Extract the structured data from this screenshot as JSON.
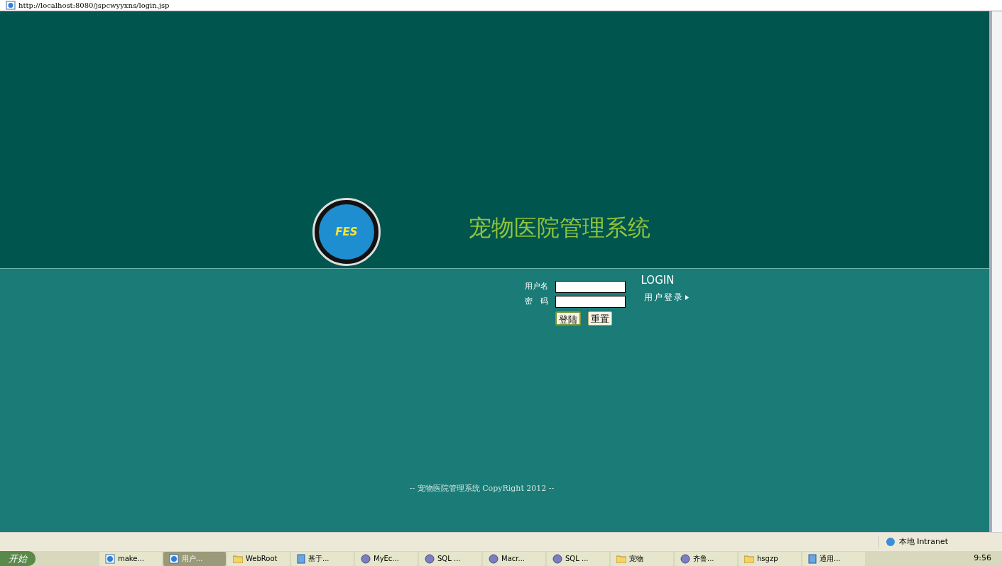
{
  "address_bar": {
    "url": "http://localhost:8080/jspcwyyxns/login.jsp"
  },
  "header": {
    "logo_text": "FES",
    "title": "宠物医院管理系统"
  },
  "login": {
    "heading": "LOGIN",
    "subheading": "用户登录",
    "fields": [
      {
        "label": "用户名"
      },
      {
        "label": "密　码"
      }
    ],
    "buttons": [
      {
        "label": "登陆",
        "focused": true
      },
      {
        "label": "重置",
        "focused": false
      }
    ]
  },
  "footer": "-- 宠物医院管理系统 CopyRight 2012 --",
  "status_bar": {
    "zone": "本地 Intranet"
  },
  "taskbar": {
    "start": "开始",
    "clock": "9:56",
    "tasks": [
      {
        "label": "make...",
        "kind": "browser",
        "selected": false
      },
      {
        "label": "用户...",
        "kind": "browser",
        "selected": true
      },
      {
        "label": "WebRoot",
        "kind": "folder",
        "selected": false
      },
      {
        "label": "基于...",
        "kind": "document",
        "selected": false
      },
      {
        "label": "MyEc...",
        "kind": "app",
        "selected": false
      },
      {
        "label": "SQL ...",
        "kind": "app",
        "selected": false
      },
      {
        "label": "Macr...",
        "kind": "app",
        "selected": false
      },
      {
        "label": "SQL ...",
        "kind": "app",
        "selected": false
      },
      {
        "label": "宠物",
        "kind": "folder",
        "selected": false
      },
      {
        "label": "齐鲁...",
        "kind": "app",
        "selected": false
      },
      {
        "label": "hsgzp",
        "kind": "folder",
        "selected": false
      },
      {
        "label": "通用...",
        "kind": "document",
        "selected": false
      }
    ]
  }
}
